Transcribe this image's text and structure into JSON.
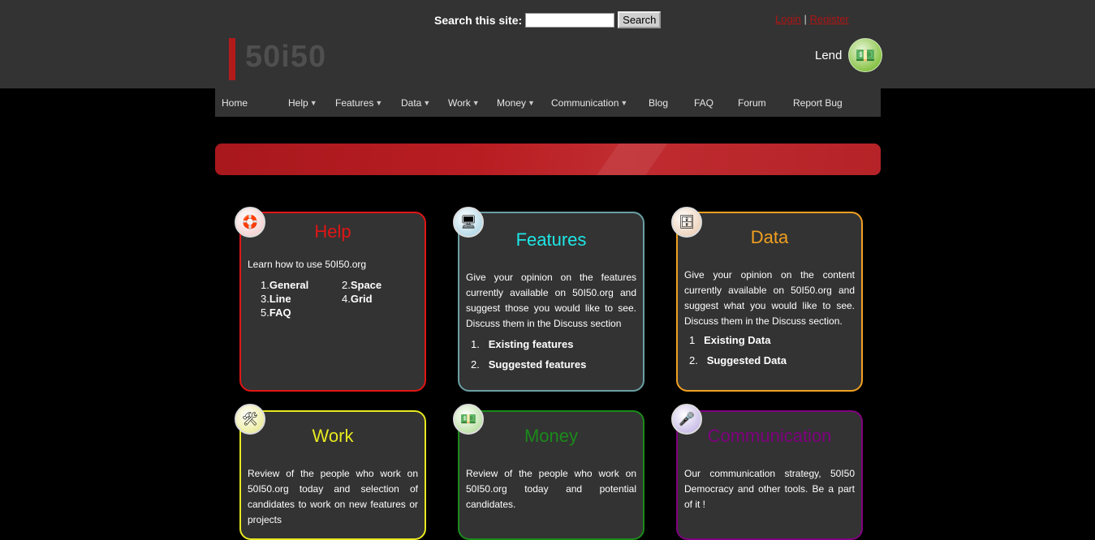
{
  "search": {
    "label": "Search this site:",
    "value": "",
    "button": "Search"
  },
  "auth": {
    "login": "Login",
    "separator": "|",
    "register": "Register"
  },
  "logo": {
    "text": "50i50"
  },
  "lend": {
    "label": "Lend",
    "icon": "money-icon"
  },
  "nav": [
    {
      "label": "Home",
      "dropdown": false
    },
    {
      "label": "Help",
      "dropdown": true
    },
    {
      "label": "Features",
      "dropdown": true
    },
    {
      "label": "Data",
      "dropdown": true
    },
    {
      "label": "Work",
      "dropdown": true
    },
    {
      "label": "Money",
      "dropdown": true
    },
    {
      "label": "Communication",
      "dropdown": true
    },
    {
      "label": "Blog",
      "dropdown": false
    },
    {
      "label": "FAQ",
      "dropdown": false
    },
    {
      "label": "Forum",
      "dropdown": false
    },
    {
      "label": "Report Bug",
      "dropdown": false
    }
  ],
  "cards": {
    "help": {
      "title": "Help",
      "color": "#e01515",
      "desc": "Learn how to use 50I50.org",
      "items": [
        {
          "num": "1.",
          "label": "General"
        },
        {
          "num": "2.",
          "label": "Space"
        },
        {
          "num": "3.",
          "label": "Line"
        },
        {
          "num": "4.",
          "label": "Grid"
        },
        {
          "num": "5.",
          "label": "FAQ"
        }
      ]
    },
    "features": {
      "title": "Features",
      "color": "#1ee6e6",
      "desc": "Give your opinion on the features currently available on 50I50.org and suggest those you would like to see. Discuss them in the Discuss section",
      "items": [
        {
          "num": "1.",
          "label": "Existing features"
        },
        {
          "num": "2.",
          "label": "Suggested features"
        }
      ]
    },
    "data": {
      "title": "Data",
      "color": "#f0a020",
      "desc": "Give your opinion on the content currently available on 50I50.org and suggest what you would like to see. Discuss them in the Discuss section.",
      "items": [
        {
          "num": "1",
          "label": "Existing Data"
        },
        {
          "num": "2.",
          "label": "Suggested Data"
        }
      ]
    },
    "work": {
      "title": "Work",
      "color": "#e8e820",
      "desc": "Review of the people who work on 50I50.org today and selection of candidates to work on new features or projects"
    },
    "money": {
      "title": "Money",
      "color": "#1a8a1a",
      "desc": "Review of the people who work on 50I50.org today and potential candidates."
    },
    "communication": {
      "title": "Communication",
      "color": "#800080",
      "desc": "Our communication strategy, 50I50 Democracy and other tools. Be a part of it !"
    }
  }
}
